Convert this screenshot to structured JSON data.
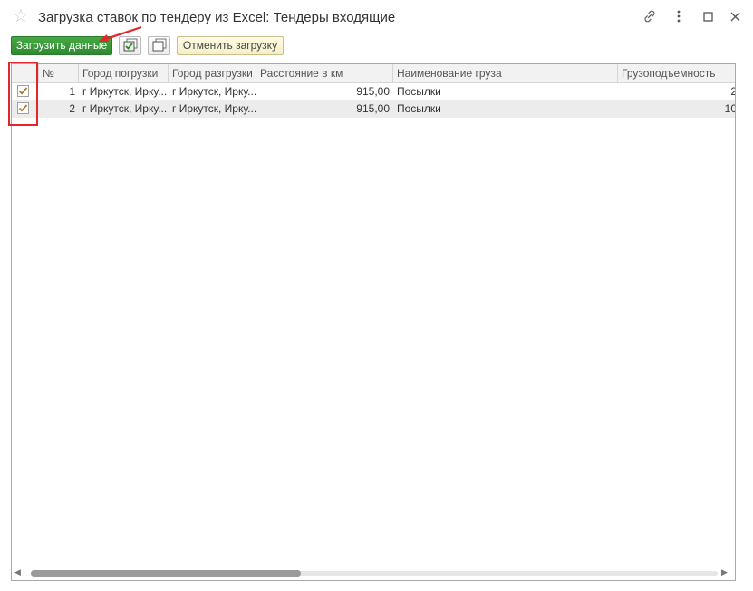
{
  "window": {
    "title": "Загрузка ставок по тендеру из Excel: Тендеры входящие",
    "icons": [
      "star-icon",
      "link-icon",
      "more-icon",
      "maximize-icon",
      "close-icon"
    ]
  },
  "toolbar": {
    "load_label": "Загрузить данные",
    "check_all_icon": "check-all-icon",
    "uncheck_all_icon": "uncheck-all-icon",
    "cancel_label": "Отменить загрузку"
  },
  "table": {
    "columns": [
      "№",
      "Город погрузки",
      "Город разгрузки",
      "Расстояние в км",
      "Наименование груза",
      "Грузоподъемность"
    ],
    "rows": [
      {
        "checked": true,
        "num": "1",
        "from": "г Иркутск, Ирку...",
        "to": "г Иркутск, Ирку...",
        "distance": "915,00",
        "cargo": "Посылки",
        "capacity": "2"
      },
      {
        "checked": true,
        "num": "2",
        "from": "г Иркутск, Ирку...",
        "to": "г Иркутск, Ирку...",
        "distance": "915,00",
        "cargo": "Посылки",
        "capacity": "10"
      }
    ]
  },
  "colors": {
    "primary_button": "#2f8a30",
    "annotation": "#e3262b",
    "check": "#b07a2a"
  }
}
